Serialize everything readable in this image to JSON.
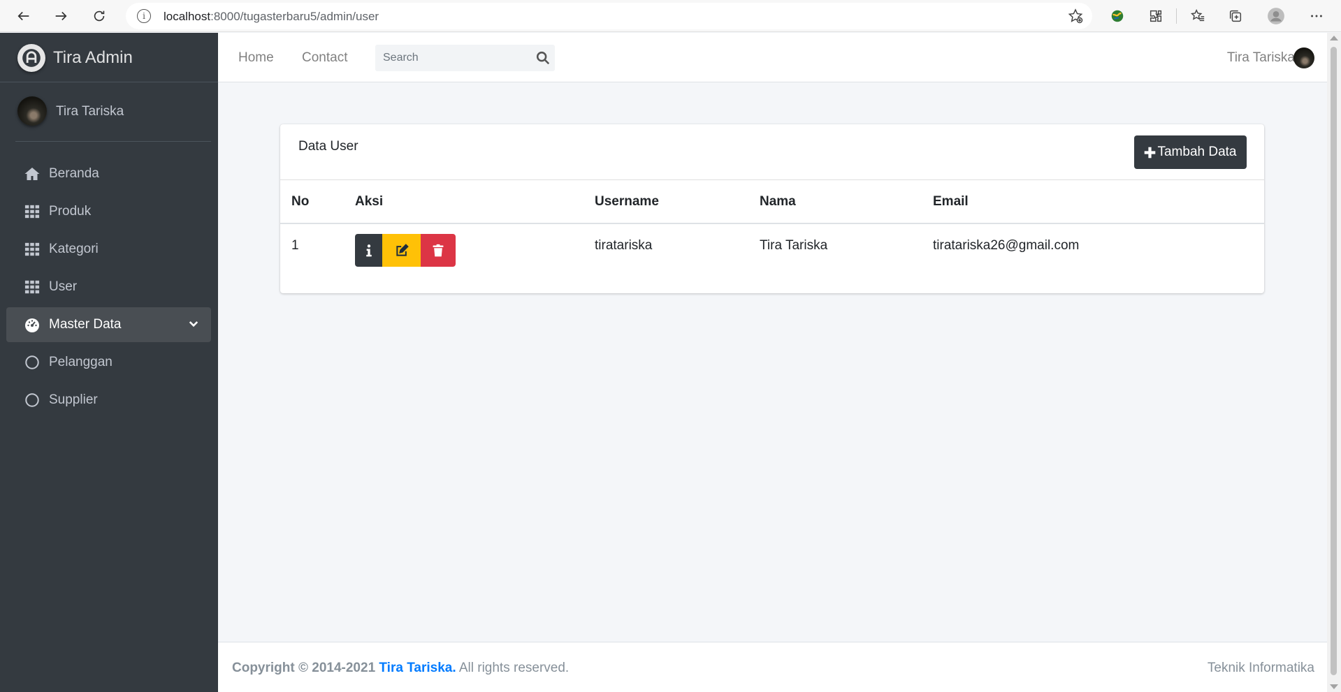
{
  "browser": {
    "url_host": "localhost",
    "url_path": ":8000/tugasterbaru5/admin/user",
    "info_glyph": "i"
  },
  "sidebar": {
    "brand": "Tira Admin",
    "user_name": "Tira Tariska",
    "items": [
      {
        "label": "Beranda",
        "icon": "home-icon"
      },
      {
        "label": "Produk",
        "icon": "grid-icon"
      },
      {
        "label": "Kategori",
        "icon": "grid-icon"
      },
      {
        "label": "User",
        "icon": "grid-icon"
      },
      {
        "label": "Master Data",
        "icon": "tachometer-icon",
        "active": true
      },
      {
        "label": "Pelanggan",
        "icon": "circle-icon"
      },
      {
        "label": "Supplier",
        "icon": "circle-icon"
      }
    ]
  },
  "navbar": {
    "home": "Home",
    "contact": "Contact",
    "search_placeholder": "Search",
    "user_name": "Tira Tariska"
  },
  "card": {
    "title": "Data User",
    "add_button": "Tambah Data",
    "columns": [
      "No",
      "Aksi",
      "Username",
      "Nama",
      "Email"
    ],
    "rows": [
      {
        "no": "1",
        "username": "tiratariska",
        "nama": "Tira Tariska",
        "email": "tiratariska26@gmail.com"
      }
    ]
  },
  "footer": {
    "copyright": "Copyright © 2014-2021",
    "owner": "Tira Tariska.",
    "rights": "All rights reserved.",
    "right_text": "Teknik Informatika"
  },
  "colors": {
    "sidebar_bg": "#343a40",
    "active_item_bg": "#494e53",
    "info_button": "#343a40",
    "edit_button": "#ffc107",
    "delete_button": "#dc3545",
    "link": "#007bff"
  }
}
